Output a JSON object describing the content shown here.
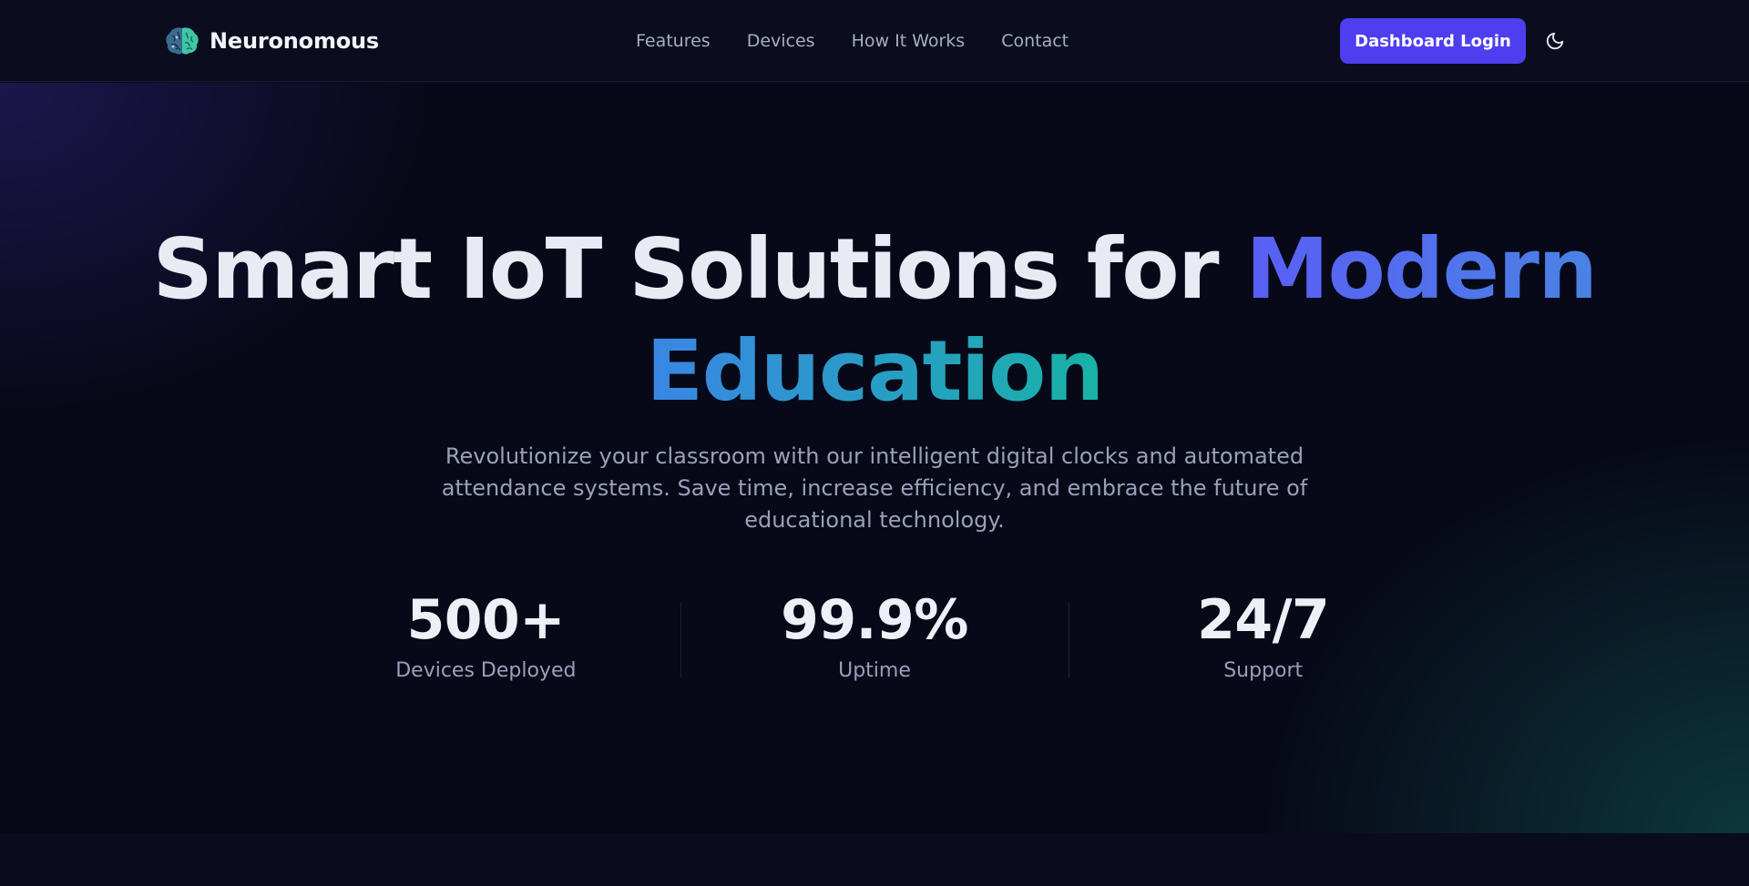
{
  "brand": {
    "name": "Neuronomous",
    "icon": "brain-icon"
  },
  "nav": {
    "links": [
      "Features",
      "Devices",
      "How It Works",
      "Contact"
    ],
    "login_label": "Dashboard Login",
    "theme_icon": "moon-icon"
  },
  "hero": {
    "headline_plain": "Smart IoT Solutions for ",
    "headline_accent_1": "Modern",
    "headline_accent_2": "Education",
    "subtitle": "Revolutionize your classroom with our intelligent digital clocks and automated attendance systems. Save time, increase efficiency, and embrace the future of educational technology."
  },
  "stats": [
    {
      "value": "500+",
      "label": "Devices Deployed"
    },
    {
      "value": "99.9%",
      "label": "Uptime"
    },
    {
      "value": "24/7",
      "label": "Support"
    }
  ],
  "colors": {
    "background": "#070918",
    "accent_button": "#4f3ef0",
    "gradient_start": "#5b5cf6",
    "gradient_end": "#18b3a6"
  }
}
